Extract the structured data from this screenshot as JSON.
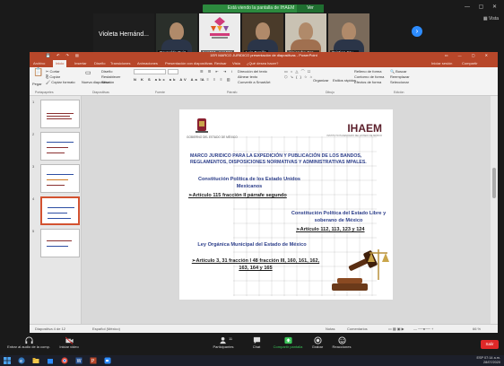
{
  "zoom": {
    "share_bar": "Está viendo la pantalla de IHAEM",
    "share_options": "Ver Opciones",
    "gallery_view": "Vista",
    "participants": [
      {
        "name": "Violeta Hernánd..."
      },
      {
        "name": "Reynaldo Ruiz"
      },
      {
        "name": "IHAEM - IHAEM"
      },
      {
        "name": "Luis Bonilla"
      },
      {
        "name": "Alejandro Gra..."
      },
      {
        "name": "Cristian Cru..."
      }
    ],
    "toolbar": {
      "audio": "Entrar al audio de la comp.",
      "video": "Iniciar video",
      "participants": "Participantes",
      "participants_count": "11",
      "chat": "Chat",
      "share": "Compartir pantalla",
      "record": "Grabar",
      "reactions": "Reacciones",
      "leave": "Salir"
    },
    "accent_color": "#2d8cff",
    "share_color": "#2c8a3e",
    "leave_color": "#e02828"
  },
  "ppt": {
    "window_title": "1ER MARCO JURIDICO presentación de diapositivas - PowerPoint",
    "tabs": [
      "Archivo",
      "Inicio",
      "Insertar",
      "Diseño",
      "Transiciones",
      "Animaciones",
      "Presentación con diapositivas",
      "Revisar",
      "Vista",
      "¿Qué desea hacer?"
    ],
    "tabs_right": [
      "Iniciar sesión",
      "Compartir"
    ],
    "ribbon": {
      "paste": "Pegar",
      "cut": "Cortar",
      "copy": "Copiar",
      "format_painter": "Copiar formato",
      "new_slide": "Nueva diapositiva",
      "design": "Diseño",
      "reset": "Restablecer",
      "section": "Sección",
      "text_direction": "Dirección del texto",
      "align_text": "Alinear texto",
      "smartart": "Convertir a SmartArt",
      "arrange": "Organizar",
      "quick_styles": "Estilos rápidos",
      "shape_fill": "Relleno de forma",
      "shape_outline": "Contorno de forma",
      "shape_effects": "Efectos de forma",
      "find": "Buscar",
      "replace": "Reemplazar",
      "select": "Seleccionar",
      "groups": [
        "Portapapeles",
        "Diapositivas",
        "Fuente",
        "Párrafo",
        "Dibujo",
        "Edición"
      ]
    },
    "brand_color": "#b7472a",
    "thumbnails": [
      1,
      2,
      3,
      4,
      5
    ],
    "status": {
      "slide_pos": "Diapositiva 4 de 12",
      "language": "Español (México)",
      "notes": "Notas",
      "comments": "Comentarios",
      "zoom": "66 %"
    }
  },
  "slide": {
    "edomex_caption": "GOBIERNO DEL ESTADO DE MÉXICO",
    "org": "IHAEM",
    "org_sub": "INSTITUTO HACENDARIO DEL ESTADO DE MÉXICO",
    "title": "MARCO JURIDICO PARA LA EXPEDICIÓN Y PUBLICACIÓN DE LOS BANDOS, REGLAMENTOS, DISPOSICIONES NORMATIVAS Y ADMINISTRATIVAS MPALES.",
    "law1": "Constitución Política de los Estado Unidos Mexicanos",
    "law1_art": "➢Artículo 115 fracción II párrafe segundo",
    "law2": "Constitución Política del Estado Libre y soberano de México",
    "law2_art": "➢Artículo 112, 113, 123 y 124",
    "law3": "Ley Orgánica Municipal del Estado de México",
    "law3_art": "➢Artículo 3, 31 fracción I 48 fracción III, 160, 161, 162, 163, 164 y 165",
    "title_color": "#2c3e8a",
    "org_color": "#5b1f2b"
  },
  "taskbar": {
    "time": "07:14 a.m.",
    "date": "28/07/2020",
    "lang": "ESP"
  }
}
